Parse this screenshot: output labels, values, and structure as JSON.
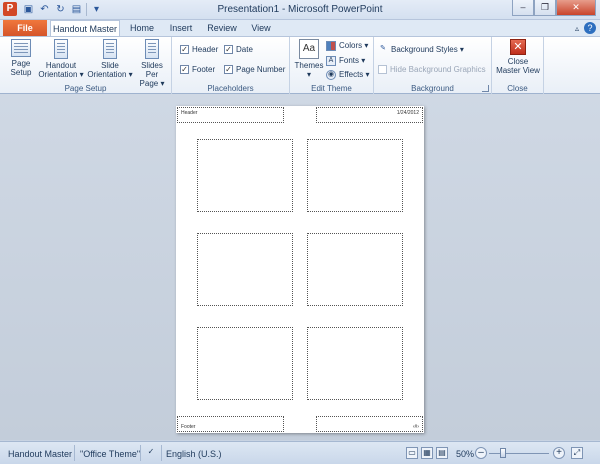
{
  "app": {
    "title": "Presentation1 - Microsoft PowerPoint",
    "icon_letter": "P",
    "help": "?"
  },
  "tabs": {
    "file": "File",
    "items": [
      "Handout Master",
      "Home",
      "Insert",
      "Review",
      "View"
    ]
  },
  "ribbon": {
    "page_setup": {
      "label": "Page Setup",
      "btn_page_setup": [
        "Page",
        "Setup"
      ],
      "btn_handout_orientation": [
        "Handout",
        "Orientation ▾"
      ],
      "btn_slide_orientation": [
        "Slide",
        "Orientation ▾"
      ],
      "btn_slides_per_page": [
        "Slides Per",
        "Page ▾"
      ]
    },
    "placeholders": {
      "label": "Placeholders",
      "header": "Header",
      "date": "Date",
      "footer": "Footer",
      "page_number": "Page Number",
      "header_checked": true,
      "date_checked": true,
      "footer_checked": true,
      "page_number_checked": true
    },
    "edit_theme": {
      "label": "Edit Theme",
      "themes": "Themes",
      "themes_icon": "Aa",
      "colors": "Colors ▾",
      "fonts": "Fonts ▾",
      "effects": "Effects ▾"
    },
    "background": {
      "label": "Background",
      "background_styles": "Background Styles ▾",
      "hide_background": "Hide Background Graphics"
    },
    "close": {
      "label": "Close",
      "btn_close": [
        "Close",
        "Master View"
      ]
    }
  },
  "handout": {
    "header_text": "Header",
    "date_text": "1/24/2012",
    "footer_text": "Footer",
    "page_number_text": "‹#›"
  },
  "status": {
    "view": "Handout Master",
    "theme": "\"Office Theme\"",
    "language": "English (U.S.)",
    "zoom": "50%",
    "zoom_fraction": 0.5
  },
  "colors": {
    "file_tab": "#d5552a",
    "accent": "#2b579a"
  }
}
